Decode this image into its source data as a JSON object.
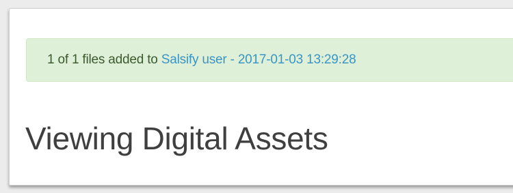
{
  "flash": {
    "prefix": "1 of 1 files added to ",
    "link_label": "Salsify user - 2017-01-03 13:29:28"
  },
  "page": {
    "title": "Viewing Digital Assets"
  },
  "colors": {
    "alert_bg": "#dff0d8",
    "alert_text": "#3c5a2f",
    "link": "#3a94c4",
    "title": "#3f3f3f"
  }
}
